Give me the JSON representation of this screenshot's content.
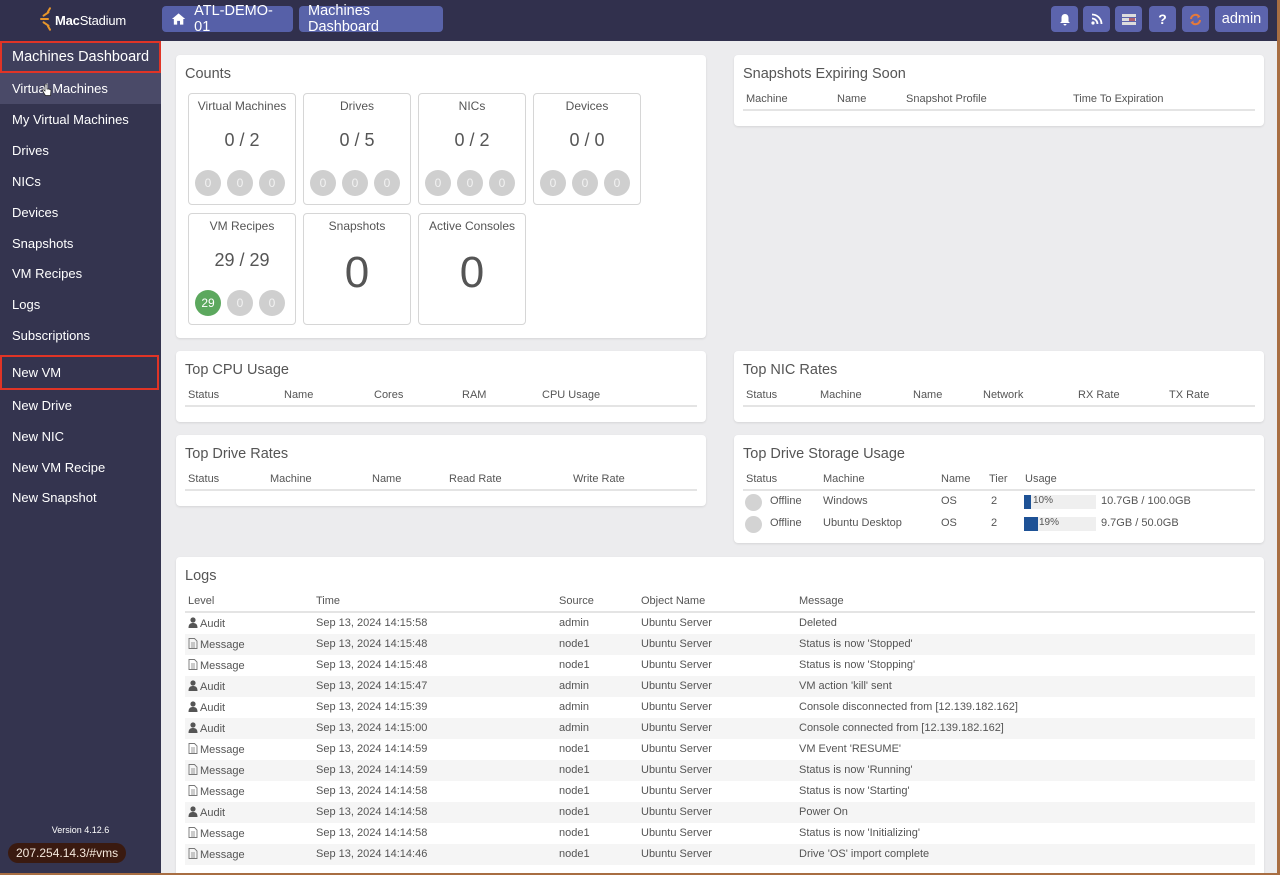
{
  "app": {
    "brand_bold": "Mac",
    "brand_rest": "Stadium",
    "version": "Version 4.12.6",
    "status_url": "207.254.14.3/#vms"
  },
  "breadcrumb": [
    {
      "label": "ATL-DEMO-01",
      "icon": "home-icon"
    },
    {
      "label": "Machines Dashboard"
    }
  ],
  "toolbar": {
    "buttons": [
      {
        "name": "notifications",
        "icon": "bell-icon"
      },
      {
        "name": "feed",
        "icon": "rss-icon"
      },
      {
        "name": "list",
        "icon": "list-icon"
      },
      {
        "name": "help",
        "icon": "question-icon",
        "glyph": "?"
      },
      {
        "name": "refresh",
        "icon": "refresh-icon",
        "color": "#e67a3a"
      }
    ],
    "user_label": "admin"
  },
  "sidebar": {
    "items": [
      {
        "label": "Machines Dashboard",
        "active": true
      },
      {
        "label": "Virtual Machines",
        "hover": true
      },
      {
        "label": "My Virtual Machines"
      },
      {
        "label": "Drives"
      },
      {
        "label": "NICs"
      },
      {
        "label": "Devices"
      },
      {
        "label": "Snapshots"
      },
      {
        "label": "VM Recipes"
      },
      {
        "label": "Logs"
      },
      {
        "label": "Subscriptions"
      },
      {
        "label": "New VM",
        "highlighted": true
      },
      {
        "label": "New Drive"
      },
      {
        "label": "New NIC"
      },
      {
        "label": "New VM Recipe"
      },
      {
        "label": "New Snapshot"
      }
    ]
  },
  "counts": {
    "title": "Counts",
    "cards": [
      {
        "label": "Virtual Machines",
        "value": "0 / 2",
        "pills": [
          "0",
          "0",
          "0"
        ]
      },
      {
        "label": "Drives",
        "value": "0 / 5",
        "pills": [
          "0",
          "0",
          "0"
        ]
      },
      {
        "label": "NICs",
        "value": "0 / 2",
        "pills": [
          "0",
          "0",
          "0"
        ]
      },
      {
        "label": "Devices",
        "value": "0 / 0",
        "pills": [
          "0",
          "0",
          "0"
        ]
      },
      {
        "label": "VM Recipes",
        "value": "29 / 29",
        "pills": [
          "29",
          "0",
          "0"
        ]
      },
      {
        "label": "Snapshots",
        "big_value": "0"
      },
      {
        "label": "Active Consoles",
        "big_value": "0"
      }
    ]
  },
  "snapshots_expiring": {
    "title": "Snapshots Expiring Soon",
    "columns": [
      "Machine",
      "Name",
      "Snapshot Profile",
      "Time To Expiration"
    ]
  },
  "top_cpu": {
    "title": "Top CPU Usage",
    "columns": [
      "Status",
      "Name",
      "Cores",
      "RAM",
      "CPU Usage"
    ]
  },
  "top_nic": {
    "title": "Top NIC Rates",
    "columns": [
      "Status",
      "Machine",
      "Name",
      "Network",
      "RX Rate",
      "TX Rate"
    ]
  },
  "top_drive_rates": {
    "title": "Top Drive Rates",
    "columns": [
      "Status",
      "Machine",
      "Name",
      "Read Rate",
      "Write Rate"
    ]
  },
  "top_storage": {
    "title": "Top Drive Storage Usage",
    "columns": [
      "Status",
      "Machine",
      "Name",
      "Tier",
      "Usage"
    ],
    "rows": [
      {
        "status": "Offline",
        "machine": "Windows",
        "name": "OS",
        "tier": "2",
        "usage_pct": 10,
        "usage_label": "10%",
        "size": "10.7GB / 100.0GB"
      },
      {
        "status": "Offline",
        "machine": "Ubuntu Desktop",
        "name": "OS",
        "tier": "2",
        "usage_pct": 19,
        "usage_label": "19%",
        "size": "9.7GB / 50.0GB"
      }
    ],
    "bar_color": "#1e5296"
  },
  "logs": {
    "title": "Logs",
    "columns": [
      "Level",
      "Time",
      "Source",
      "Object Name",
      "Message"
    ],
    "rows": [
      {
        "level": "Audit",
        "time": "Sep 13, 2024 14:15:58",
        "source": "admin",
        "object": "Ubuntu Server",
        "message": "Deleted"
      },
      {
        "level": "Message",
        "time": "Sep 13, 2024 14:15:48",
        "source": "node1",
        "object": "Ubuntu Server",
        "message": "Status is now 'Stopped'"
      },
      {
        "level": "Message",
        "time": "Sep 13, 2024 14:15:48",
        "source": "node1",
        "object": "Ubuntu Server",
        "message": "Status is now 'Stopping'"
      },
      {
        "level": "Audit",
        "time": "Sep 13, 2024 14:15:47",
        "source": "admin",
        "object": "Ubuntu Server",
        "message": "VM action 'kill' sent"
      },
      {
        "level": "Audit",
        "time": "Sep 13, 2024 14:15:39",
        "source": "admin",
        "object": "Ubuntu Server",
        "message": "Console disconnected from [12.139.182.162]"
      },
      {
        "level": "Audit",
        "time": "Sep 13, 2024 14:15:00",
        "source": "admin",
        "object": "Ubuntu Server",
        "message": "Console connected from [12.139.182.162]"
      },
      {
        "level": "Message",
        "time": "Sep 13, 2024 14:14:59",
        "source": "node1",
        "object": "Ubuntu Server",
        "message": "VM Event 'RESUME'"
      },
      {
        "level": "Message",
        "time": "Sep 13, 2024 14:14:59",
        "source": "node1",
        "object": "Ubuntu Server",
        "message": "Status is now 'Running'"
      },
      {
        "level": "Message",
        "time": "Sep 13, 2024 14:14:58",
        "source": "node1",
        "object": "Ubuntu Server",
        "message": "Status is now 'Starting'"
      },
      {
        "level": "Audit",
        "time": "Sep 13, 2024 14:14:58",
        "source": "node1",
        "object": "Ubuntu Server",
        "message": "Power On"
      },
      {
        "level": "Message",
        "time": "Sep 13, 2024 14:14:58",
        "source": "node1",
        "object": "Ubuntu Server",
        "message": "Status is now 'Initializing'"
      },
      {
        "level": "Message",
        "time": "Sep 13, 2024 14:14:46",
        "source": "node1",
        "object": "Ubuntu Server",
        "message": "Drive 'OS' import complete"
      }
    ]
  }
}
